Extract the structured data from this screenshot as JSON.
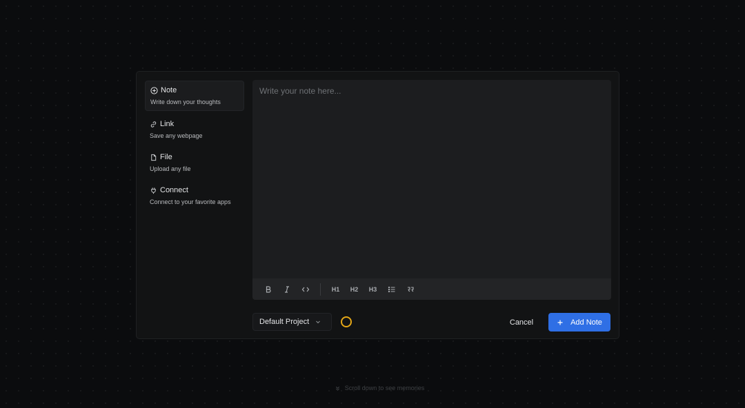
{
  "sidebar": {
    "items": [
      {
        "label": "Note",
        "description": "Write down your thoughts",
        "icon": "note-icon",
        "active": true
      },
      {
        "label": "Link",
        "description": "Save any webpage",
        "icon": "link-icon",
        "active": false
      },
      {
        "label": "File",
        "description": "Upload any file",
        "icon": "file-icon",
        "active": false
      },
      {
        "label": "Connect",
        "description": "Connect to your favorite apps",
        "icon": "plug-icon",
        "active": false
      }
    ]
  },
  "editor": {
    "placeholder": "Write your note here...",
    "value": "",
    "toolbar": {
      "h1": "H1",
      "h2": "H2",
      "h3": "H3",
      "icons": [
        "bold-icon",
        "italic-icon",
        "code-icon",
        "heading-1-icon",
        "heading-2-icon",
        "heading-3-icon",
        "bullet-list-icon",
        "quote-icon"
      ]
    }
  },
  "footer": {
    "project": "Default Project",
    "cancel_label": "Cancel",
    "add_label": "Add Note"
  },
  "scroll_hint": "Scroll down to see memories",
  "colors": {
    "accent": "#2f6fe5",
    "spinner": "#e6a817",
    "background": "#0b0c0e",
    "panel": "#121314"
  }
}
